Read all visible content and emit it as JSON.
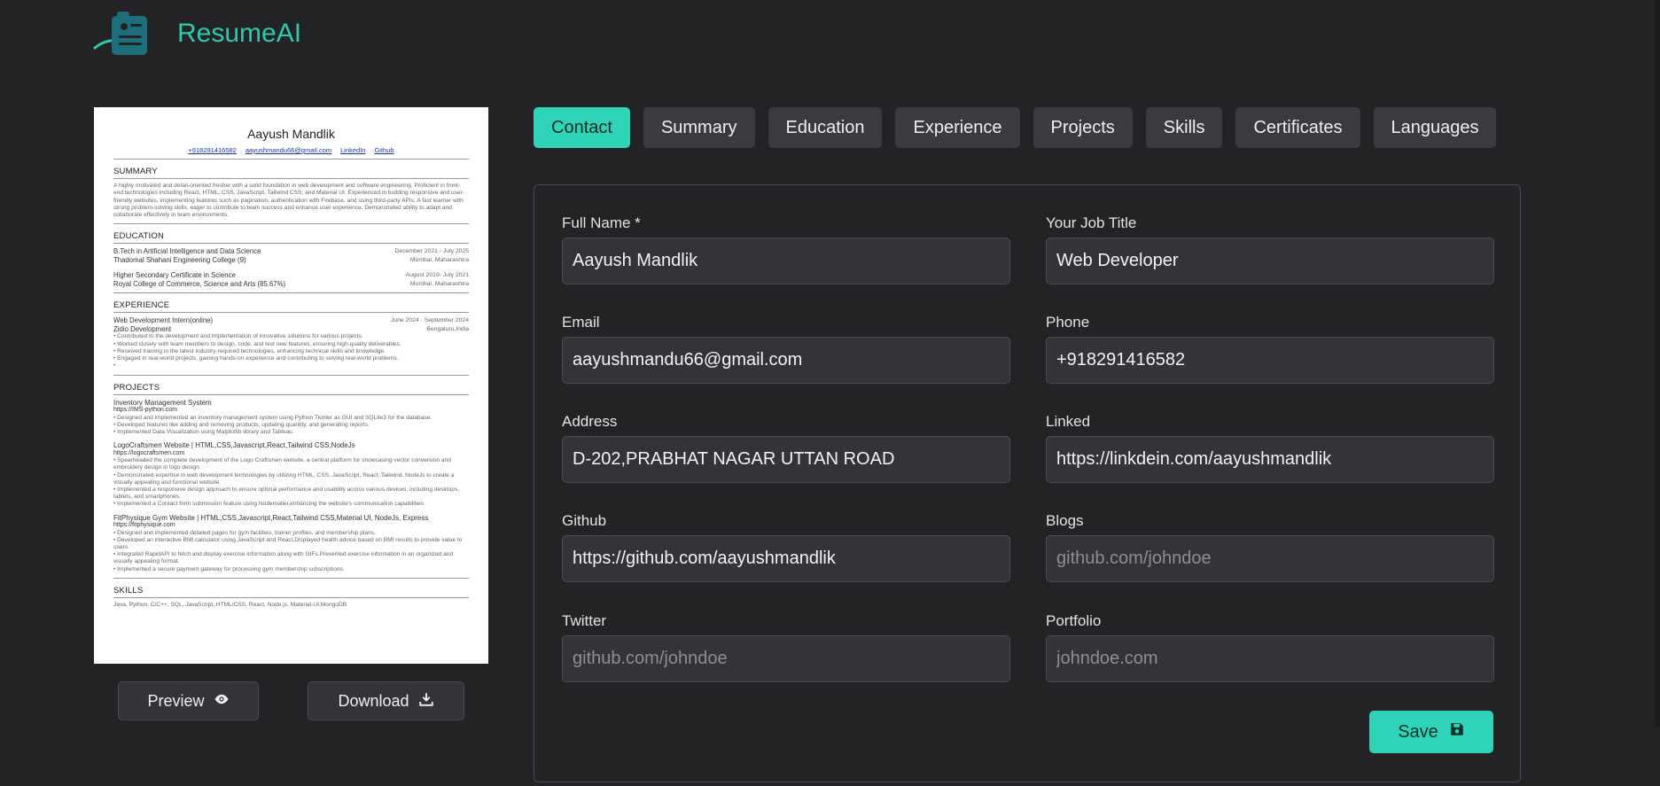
{
  "header": {
    "brand": "ResumeAI"
  },
  "resume": {
    "name": "Aayush Mandlik",
    "contacts": [
      "+918291416582",
      "aayushmandu66@gmail.com",
      "LinkedIn",
      "Github"
    ],
    "summary_title": "SUMMARY",
    "summary_text": "A highly motivated and detail-oriented fresher with a solid foundation in web development and software engineering. Proficient in front-end technologies including React, HTML, CSS, JavaScript, Tailwind CSS, and Material UI. Experienced in building responsive and user-friendly websites, implementing features such as pagination, authentication with Firebase, and using third-party APIs. A fast learner with strong problem-solving skills, eager to contribute to team success and enhance user experience. Demonstrated ability to adapt and collaborate effectively in team environments.",
    "education_title": "EDUCATION",
    "edu1_degree": "B.Tech in Artificial Intelligence and Data Science",
    "edu1_dates": "December 2021 - July 2025",
    "edu1_school": "Thadomal Shahani Engineering College  (9)",
    "edu1_loc": "Mumbai, Maharashtra",
    "edu2_degree": "Higher Secondary Certificate in Science",
    "edu2_dates": "August 2019- July 2021",
    "edu2_school": "Royal College of Commerce, Science and Arts  (85.67%)",
    "edu2_loc": "Mumbai, Maharashtra",
    "experience_title": "EXPERIENCE",
    "exp_role": "Web Development Intern(online)",
    "exp_dates": "June 2024 - September 2024",
    "exp_company": "Zidio Development",
    "exp_loc": "Bengaluru,India",
    "exp_bullets": [
      "Contributed to the development and implementation of innovative solutions for various projects.",
      "Worked closely with team members to design, code, and test new features, ensuring high-quality deliverables.",
      "Received training in the latest industry-required technologies, enhancing technical skills and knowledge.",
      "Engaged in real-world projects, gaining hands-on experience and contributing to solving real-world problems.",
      ""
    ],
    "projects_title": "PROJECTS",
    "proj1_name": "Inventory Management System",
    "proj1_link": "https://IMS-python.com",
    "proj1_bullets": [
      "Designed and implemented an inventory management system using Python Tkinter as GUI and SQLite3 for the database.",
      "Developed features like adding and removing products, updating quantity, and generating reports.",
      "Implemented Data Visualization using Matplotlib library and Tableau."
    ],
    "proj2_name": "LogoCraftsmen Website | HTML,CSS,Javascript,React,Tailwind CSS,NodeJs",
    "proj2_link": "https://logocraftsmen.com",
    "proj2_bullets": [
      "Spearheaded the complete development of the Logo Craftsmen website, a central platform for showcasing vector conversion and embroidery design in logo design.",
      "Demonstrated expertise in web development technologies by utilizing HTML, CSS, JavaScript, React, Tailwind, NodeJs to create a visually appealing and functional website.",
      "Implemented a responsive design approach to ensure optimal performance and usability across various devices, including desktops, tablets, and smartphones.",
      "Implemented a Contact form submission feature using Nodemailer,enhancing the website's communication capabilities"
    ],
    "proj3_name": "FitPhysique Gym Website | HTML,CSS,Javascript,React,Tailwind CSS,Material UI, NodeJs, Express",
    "proj3_link": "https://fitphysique.com",
    "proj3_bullets": [
      "Designed and implemented detailed pages for gym facilities, trainer profiles, and membership plans.",
      "Developed an interactive BMI calculator using JavaScript and React.Displayed health advice based on BMI results to provide value to users.",
      "Integrated RapidAPI to fetch and display exercise information along with GIFs.Presented exercise information in an organized and visually appealing format.",
      "Implemented a secure payment gateway for processing gym membership subscriptions."
    ],
    "skills_title": "SKILLS",
    "skills_text": "Java, Python, C/C++, SQL, JavaScript, HTML/CSS, React, Node.js, Material-UI,MongoDB"
  },
  "preview_buttons": {
    "preview_label": "Preview",
    "download_label": "Download"
  },
  "tabs": [
    {
      "label": "Contact",
      "active": true
    },
    {
      "label": "Summary"
    },
    {
      "label": "Education"
    },
    {
      "label": "Experience"
    },
    {
      "label": "Projects"
    },
    {
      "label": "Skills"
    },
    {
      "label": "Certificates"
    },
    {
      "label": "Languages"
    }
  ],
  "form": {
    "full_name": {
      "label": "Full Name *",
      "value": "Aayush Mandlik",
      "placeholder": ""
    },
    "job_title": {
      "label": "Your Job Title",
      "value": "Web Developer",
      "placeholder": ""
    },
    "email": {
      "label": "Email",
      "value": "aayushmandu66@gmail.com",
      "placeholder": ""
    },
    "phone": {
      "label": "Phone",
      "value": "+918291416582",
      "placeholder": ""
    },
    "address": {
      "label": "Address",
      "value": "D-202,PRABHAT NAGAR UTTAN ROAD",
      "placeholder": ""
    },
    "linked": {
      "label": "Linked",
      "value": "https://linkdein.com/aayushmandlik",
      "placeholder": ""
    },
    "github": {
      "label": "Github",
      "value": "https://github.com/aayushmandlik",
      "placeholder": ""
    },
    "blogs": {
      "label": "Blogs",
      "value": "",
      "placeholder": "github.com/johndoe"
    },
    "twitter": {
      "label": "Twitter",
      "value": "",
      "placeholder": "github.com/johndoe"
    },
    "portfolio": {
      "label": "Portfolio",
      "value": "",
      "placeholder": "johndoe.com"
    },
    "save_label": "Save"
  },
  "colors": {
    "accent": "#2fd3b7",
    "brand": "#2fc9a9",
    "background": "#232326",
    "input_bg": "#333338"
  }
}
